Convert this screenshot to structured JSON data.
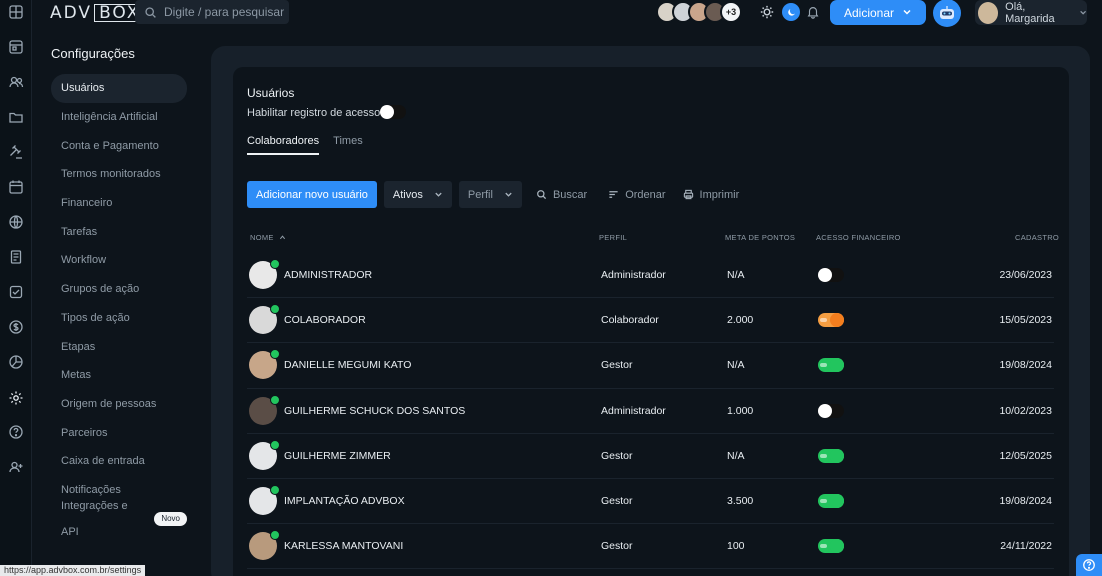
{
  "brand": {
    "logo_left": "ADV",
    "logo_right": "BOX"
  },
  "search": {
    "placeholder": "Digite / para pesquisar"
  },
  "header": {
    "extra_avatars": "+3",
    "add_button": "Adicionar",
    "greeting": "Olá, Margarida",
    "accent": "#2e8df7"
  },
  "rail_icons": [
    "dashboard-icon",
    "calendar-board-icon",
    "people-icon",
    "folder-icon",
    "gavel-icon",
    "calendar-icon",
    "globe-icon",
    "documents-icon",
    "checkbox-icon",
    "dollar-icon",
    "pie-chart-icon",
    "gear-icon",
    "help-icon",
    "user-plus-icon"
  ],
  "settings": {
    "title": "Configurações",
    "items": [
      {
        "label": "Usuários",
        "active": true
      },
      {
        "label": "Inteligência Artificial"
      },
      {
        "label": "Conta e Pagamento"
      },
      {
        "label": "Termos monitorados"
      },
      {
        "label": "Financeiro"
      },
      {
        "label": "Tarefas"
      },
      {
        "label": "Workflow"
      },
      {
        "label": "Grupos de ação"
      },
      {
        "label": "Tipos de ação"
      },
      {
        "label": "Etapas"
      },
      {
        "label": "Metas"
      },
      {
        "label": "Origem de pessoas"
      },
      {
        "label": "Parceiros"
      },
      {
        "label": "Caixa de entrada"
      },
      {
        "label": "Notificações"
      },
      {
        "label": "Integrações e API",
        "badge": "Novo"
      }
    ]
  },
  "users": {
    "title": "Usuários",
    "enable_label": "Habilitar registro de acessos",
    "tabs": [
      "Colaboradores",
      "Times"
    ],
    "toolbar": {
      "add_button": "Adicionar novo usuário",
      "status_select": "Ativos",
      "profile_select": "Perfil",
      "search": "Buscar",
      "sort": "Ordenar",
      "print": "Imprimir"
    },
    "columns": {
      "name": "NOME",
      "profile": "PERFIL",
      "goal": "META DE PONTOS",
      "financial": "ACESSO FINANCEIRO",
      "created": "CADASTRO"
    },
    "rows": [
      {
        "name": "ADMINISTRADOR",
        "profile": "Administrador",
        "goal": "N/A",
        "financial": "off",
        "created": "23/06/2023"
      },
      {
        "name": "COLABORADOR",
        "profile": "Colaborador",
        "goal": "2.000",
        "financial": "on-orange",
        "created": "15/05/2023"
      },
      {
        "name": "DANIELLE MEGUMI KATO",
        "profile": "Gestor",
        "goal": "N/A",
        "financial": "on-green",
        "created": "19/08/2024"
      },
      {
        "name": "GUILHERME SCHUCK DOS SANTOS",
        "profile": "Administrador",
        "goal": "1.000",
        "financial": "off",
        "created": "10/02/2023"
      },
      {
        "name": "GUILHERME ZIMMER",
        "profile": "Gestor",
        "goal": "N/A",
        "financial": "on-green",
        "created": "12/05/2025"
      },
      {
        "name": "IMPLANTAÇÃO ADVBOX",
        "profile": "Gestor",
        "goal": "3.500",
        "financial": "on-green",
        "created": "19/08/2024"
      },
      {
        "name": "KARLESSA MANTOVANI",
        "profile": "Gestor",
        "goal": "100",
        "financial": "on-green",
        "created": "24/11/2022"
      }
    ]
  },
  "status_bar": {
    "url": "https://app.advbox.com.br/settings"
  }
}
